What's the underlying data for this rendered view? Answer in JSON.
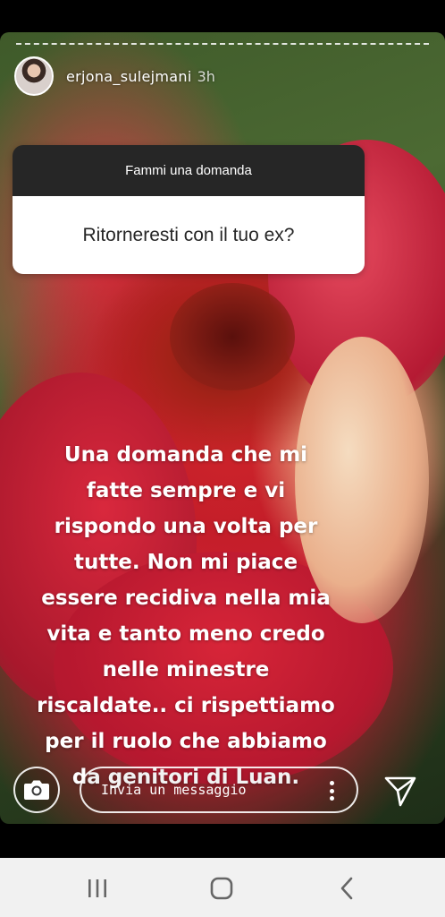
{
  "story": {
    "author": {
      "username": "erjona_sulejmani",
      "time_ago": "3h"
    },
    "question_sticker": {
      "header": "Fammi una domanda",
      "question": "Ritorneresti con il tuo ex?"
    },
    "caption_lines": [
      "Una domanda che mi",
      "fatte sempre e vi",
      "rispondo una volta per",
      "tutte. Non mi piace",
      "essere recidiva nella mia",
      "vita e tanto meno credo",
      "nelle minestre",
      "riscaldate.. ci rispettiamo",
      "per il ruolo che abbiamo",
      "da genitori di Luan."
    ],
    "reply": {
      "placeholder": "Invia un messaggio"
    }
  },
  "icons": {
    "camera": "camera-icon",
    "more": "more-vertical-icon",
    "send": "send-icon",
    "recent_apps": "recent-apps-icon",
    "home": "home-icon",
    "back": "back-icon"
  },
  "colors": {
    "sticker_header_bg": "#262626",
    "sticker_body_bg": "#ffffff",
    "nav_bar_bg": "#f1f1f1"
  }
}
